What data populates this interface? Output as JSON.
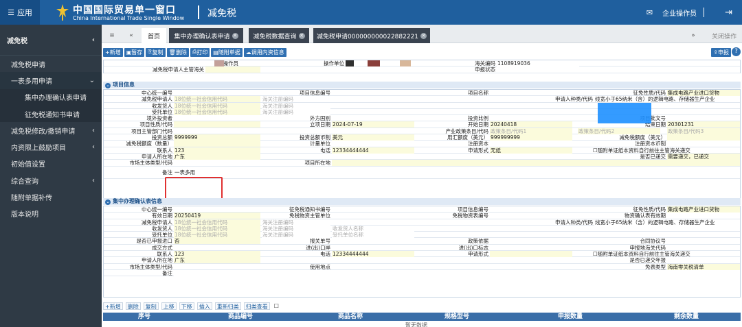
{
  "header": {
    "app_label": "应用",
    "brand_cn": "中国国际贸易单一窗口",
    "brand_en": "China International Trade Single Window",
    "module": "减免税",
    "user": "企业操作员"
  },
  "sidebar": {
    "title": "减免税",
    "items": [
      {
        "label": "减免税申请",
        "arrow": ""
      },
      {
        "label": "一表多用申请",
        "arrow": "⌄",
        "open": true
      },
      {
        "label": "集中办理确认表申请",
        "arrow": "",
        "sub": true
      },
      {
        "label": "征免税通知书申请",
        "arrow": "",
        "sub": true
      },
      {
        "label": "减免税修改/撤销申请",
        "arrow": "‹"
      },
      {
        "label": "内资限上鼓励项目",
        "arrow": "‹"
      },
      {
        "label": "初始值设置",
        "arrow": ""
      },
      {
        "label": "综合查询",
        "arrow": "‹"
      },
      {
        "label": "随附单据补传",
        "arrow": ""
      },
      {
        "label": "版本说明",
        "arrow": ""
      }
    ]
  },
  "tabs": {
    "home": "首页",
    "t1": "集中办理确认表申请",
    "t2": "减免税数据查询",
    "t3": "减免税申请000000000022882221",
    "close_ops": "关闭操作"
  },
  "toolbar": {
    "add": "+新增",
    "save": "暂存",
    "copy": "复制",
    "delete": "删除",
    "print": "打印",
    "attach": "随附单据",
    "import": "调用内资信息",
    "declare": "申报"
  },
  "top_fields": {
    "operator": "操作员",
    "operator_unit": "操作单位",
    "customs_code_label": "海关编码",
    "customs_code": "1108919036",
    "applicant_customs": "减免税申请人主管海关",
    "declare_status": "申报状态"
  },
  "section1": {
    "title": "项目信息",
    "r1": [
      "中心统一编号",
      "项目信息编号",
      "项目名称",
      "征免性质/代码",
      "集成电路产业进口货物"
    ],
    "r2": [
      "减免税申请人",
      "18位统一社会信用代码",
      "海关注册编码",
      "申请人种类/代码",
      "线宽小于65纳米（含）的逻辑电路、存储器生产企业"
    ],
    "r3": [
      "收发货人",
      "18位统一社会信用代码",
      "海关注册编码"
    ],
    "r4": [
      "受托单位",
      "18位统一社会信用代码",
      "海关注册编码"
    ],
    "r5": [
      "境外投资者",
      "外方国别",
      "投资比例",
      "项目批文号"
    ],
    "r6": [
      "项目性质/代码",
      "立项日期",
      "2024-07-19",
      "开始日期",
      "20240418",
      "结束日期",
      "20301231"
    ],
    "r7": [
      "项目主管部门代码",
      "产业政策条目/代码",
      "政策条目/代码1",
      "政策条目/代码2",
      "政策条目/代码3"
    ],
    "r8": [
      "投资总额",
      "9999999",
      "投资总额币制",
      "美元",
      "用汇额度（美元）",
      "999999999",
      "减免税额度（美元）"
    ],
    "r9": [
      "减免税额度（数量）",
      "计量单位",
      "注册资本",
      "注册资本币制"
    ],
    "r10": [
      "联系人",
      "123",
      "电话",
      "12334444444",
      "申请形式",
      "无纸",
      "随附单证纸本资料自行前往主管海关递交"
    ],
    "r11": [
      "申请人所在地",
      "广东",
      "是否已递交",
      "需要递交，已递交"
    ],
    "r12": [
      "市场主体类型/代码",
      "项目所在地"
    ],
    "r13": [
      "备注",
      "一表多用"
    ]
  },
  "section2": {
    "title": "集中办理确认表信息",
    "r1": [
      "中心统一编号",
      "征免税通知书编号",
      "项目信息编号",
      "征免性质/代码",
      "集成电路产业进口货物"
    ],
    "r2": [
      "有效日期",
      "20250419",
      "免税物资主管单位",
      "免税物资表编号",
      "物资确认表有效期"
    ],
    "r3": [
      "减免税申请人",
      "18位统一社会信用代码",
      "海关注册编码",
      "申请人种类/代码",
      "线宽小于65纳米（含）的逻辑电路、存储器生产企业"
    ],
    "r4": [
      "收发货人",
      "18位统一社会信用代码",
      "海关注册编码",
      "收发货人名称"
    ],
    "r5": [
      "受托单位",
      "18位统一社会信用代码",
      "海关注册编码",
      "受托单位名称"
    ],
    "r6": [
      "是否已申报进口",
      "否",
      "报关单号",
      "政策依据",
      "合同协议号"
    ],
    "r7": [
      "成交方式",
      "进(出)口岸",
      "进(出)口标志",
      "申报地海关代码"
    ],
    "r8": [
      "联系人",
      "123",
      "电话",
      "12334444444",
      "申请形式",
      "随附单证纸本资料自行前往主管海关递交"
    ],
    "r9": [
      "申请人所在地",
      "广东",
      "是否已递交年报"
    ],
    "r10": [
      "市场主体类型/代码",
      "使用地点",
      "免表类型",
      "海南零关税清单"
    ],
    "r11": [
      "备注"
    ]
  },
  "list_toolbar": [
    "+新增",
    "删除",
    "复制",
    "上移",
    "下移",
    "插入",
    "重新归类",
    "归类查看"
  ],
  "table": {
    "headers": [
      "序号",
      "商品编号",
      "商品名称",
      "规格型号",
      "申报数量",
      "剩余数量"
    ],
    "empty": "暂无数据"
  }
}
